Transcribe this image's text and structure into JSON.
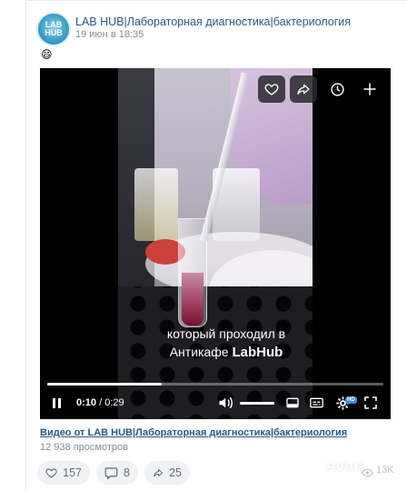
{
  "post": {
    "avatar_text": "LAB HUB",
    "author": "LAB HUB|Лабораторная диагностика|бактериология",
    "date": "19 июн в 18:35",
    "emoji": "😄"
  },
  "video": {
    "subtitle_line1": "который проходил в",
    "subtitle_line2_prefix": "Антикафе ",
    "subtitle_line2_brand": "LabHub",
    "current_time": "0:10",
    "separator": " / ",
    "duration": "0:29",
    "progress_fraction": 0.34,
    "volume_fraction": 1.0,
    "quality_badge": "HD",
    "title": "Видео от LAB HUB|Лабораторная диагностика|бактериология",
    "views": "12 938 просмотров"
  },
  "actions": {
    "likes": "157",
    "comments": "8",
    "shares": "25",
    "view_count": "13K"
  },
  "watermark": "Avito",
  "colors": {
    "link": "#2a5885",
    "meta": "#818c99",
    "action_bg": "#f0f2f5",
    "accent": "#3f8ae0"
  }
}
